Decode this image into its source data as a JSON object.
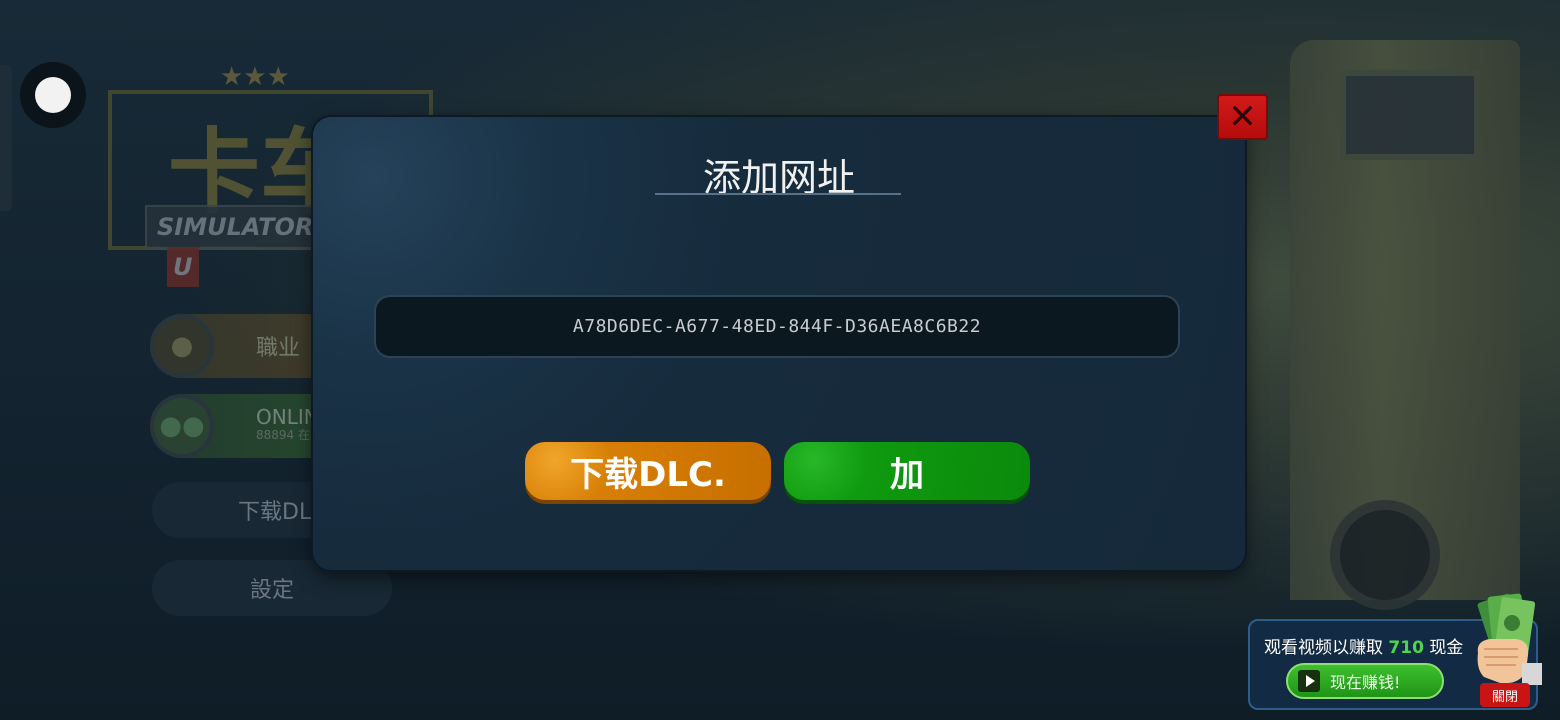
{
  "background": {
    "logo_main": "卡车",
    "logo_banner": "SIMULATOR",
    "logo_banner_tail": "U",
    "menu": {
      "career": "職业",
      "online": "ONLINE",
      "online_sub": "88894 在",
      "download_dlc": "下载DL",
      "settings": "設定"
    }
  },
  "dialog": {
    "title": "添加网址",
    "url_value": "A78D6DEC-A677-48ED-844F-D36AEA8C6B22",
    "download_button": "下载DLC.",
    "add_button": "加",
    "close_symbol": "✕"
  },
  "reward_ad": {
    "text_prefix": "观看视频以赚取",
    "amount": "710",
    "text_suffix": "现金",
    "earn_button": "现在赚钱!",
    "close_label": "關閉"
  },
  "icons": {
    "pause": "pause-icon",
    "close": "close-icon",
    "play": "play-icon",
    "money_hand": "money-hand-icon"
  },
  "colors": {
    "download_button": "#c76e00",
    "add_button": "#0b8a0b",
    "close_button": "#c81414",
    "reward_amount": "#4cd64c"
  }
}
